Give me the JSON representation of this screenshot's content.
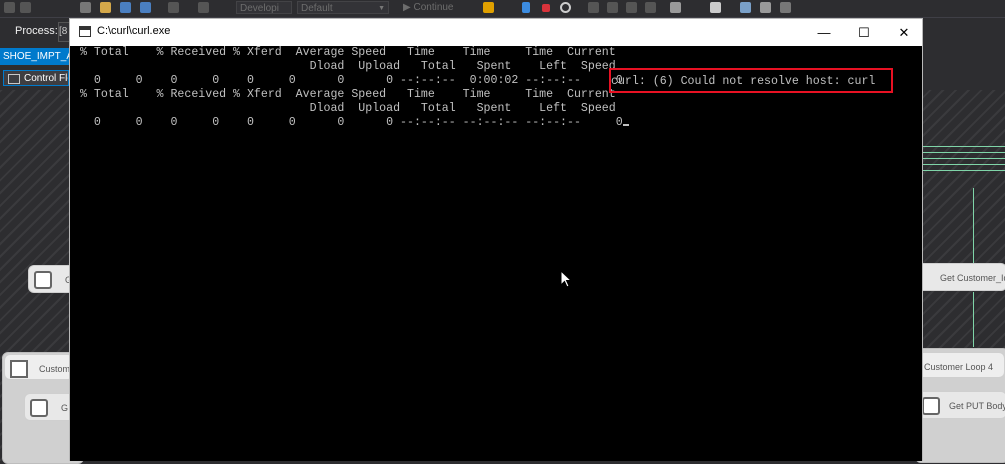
{
  "ide": {
    "toolbar": {
      "config_combo": "Developi",
      "platform_combo": "Default",
      "continue_label": "Continue"
    },
    "process_label": "Process:",
    "process_value": "[8",
    "doc_tab": "SHOE_IMPT_A",
    "subtab": "Control Flo",
    "tasks": {
      "left_1": "G",
      "container_left": "Custom",
      "left_2": "G",
      "right_1": "Get Customer_Id",
      "right_container": "Customer Loop 4",
      "right_2": "Get PUT Body"
    }
  },
  "console": {
    "title": "C:\\curl\\curl.exe",
    "minimize": "—",
    "maximize": "☐",
    "close": "✕",
    "lines": [
      "% Total    % Received % Xferd  Average Speed   Time    Time     Time  Current",
      "                                 Dload  Upload   Total   Spent    Left  Speed",
      "  0     0    0     0    0     0      0      0 --:--:--  0:00:02 --:--:--     0",
      "% Total    % Received % Xferd  Average Speed   Time    Time     Time  Current",
      "                                 Dload  Upload   Total   Spent    Left  Speed",
      "  0     0    0     0    0     0      0      0 --:--:-- --:--:-- --:--:--     0"
    ],
    "error_message": "curl: (6) Could not resolve host: curl"
  }
}
